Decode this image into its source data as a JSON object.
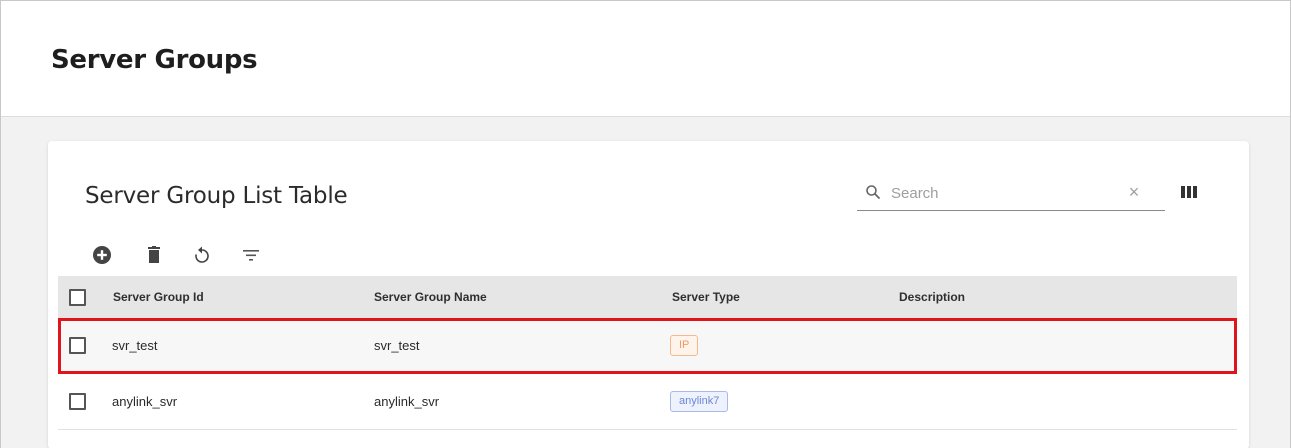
{
  "header": {
    "title": "Server Groups"
  },
  "table": {
    "title": "Server Group List Table",
    "search": {
      "placeholder": "Search",
      "value": ""
    },
    "toolbar": [
      "add-circle-icon",
      "trash-icon",
      "refresh-icon",
      "filter-icon"
    ],
    "columns": {
      "id": "Server Group Id",
      "name": "Server Group Name",
      "type": "Server Type",
      "desc": "Description"
    },
    "rows": [
      {
        "id": "svr_test",
        "name": "svr_test",
        "type": "IP",
        "desc": "",
        "type_color": "#f29b62",
        "type_bg": "#fff4ec",
        "selected": true
      },
      {
        "id": "anylink_svr",
        "name": "anylink_svr",
        "type": "anylink7",
        "desc": "",
        "type_color": "#6c86d6",
        "type_bg": "#eef2fd",
        "selected": false
      }
    ]
  },
  "colors": {
    "highlight": "#e0141c",
    "header_bg": "#e6e6e6"
  }
}
